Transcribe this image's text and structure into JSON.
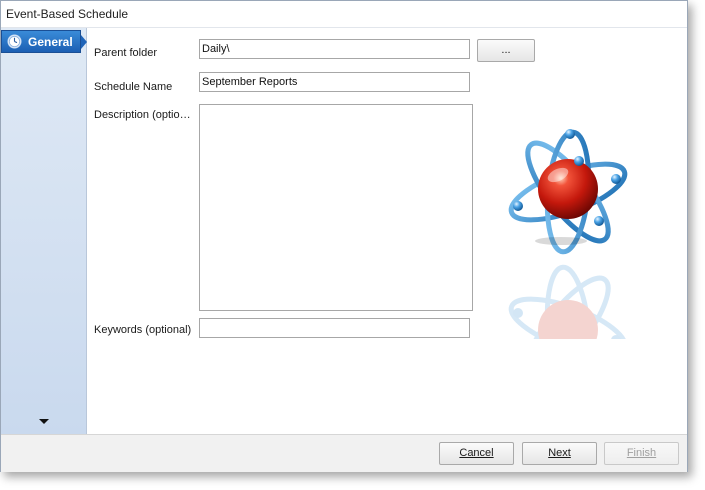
{
  "window": {
    "title": "Event-Based Schedule"
  },
  "sidebar": {
    "items": [
      {
        "label": "General",
        "icon": "clock-icon"
      }
    ],
    "scroll_icon": "chevron-down-icon"
  },
  "form": {
    "parent_folder": {
      "label": "Parent folder",
      "value": "Daily\\",
      "browse_label": "..."
    },
    "schedule_name": {
      "label": "Schedule Name",
      "value": "September Reports"
    },
    "description": {
      "label": "Description (optio…",
      "value": ""
    },
    "keywords": {
      "label": "Keywords (optional)",
      "value": ""
    }
  },
  "illustration": {
    "icon": "atom-icon"
  },
  "footer": {
    "cancel_label": "Cancel",
    "next_label": "Next",
    "finish_label": "Finish"
  }
}
